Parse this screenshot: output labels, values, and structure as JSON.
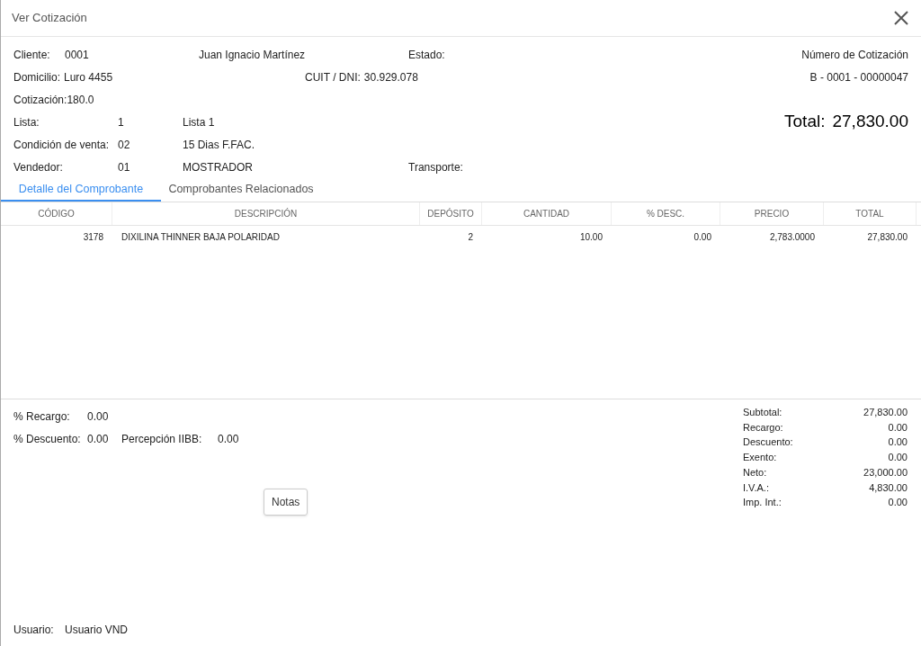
{
  "window": {
    "title": "Ver Cotización"
  },
  "header": {
    "cliente_label": "Cliente:",
    "cliente_code": "0001",
    "cliente_name": "Juan Ignacio Martínez",
    "estado_label": "Estado:",
    "numero_label": "Número de Cotización",
    "numero": "B - 0001 - 00000047",
    "domicilio_label": "Domicilio:",
    "domicilio": "Luro 4455",
    "cuit_label": "CUIT / DNI:",
    "cuit": "30.929.078",
    "cotizacion_label": "Cotización:",
    "cotizacion": "180.0",
    "total_label": "Total:",
    "total": "27,830.00"
  },
  "fields": [
    {
      "label": "Lista:",
      "code": "1",
      "name": "Lista 1"
    },
    {
      "label": "Condición de venta:",
      "code": "02",
      "name": "15 Dias F.FAC."
    },
    {
      "label": "Vendedor:",
      "code": "01",
      "name": "MOSTRADOR"
    }
  ],
  "transporte_label": "Transporte:",
  "tabs": [
    {
      "label": "Detalle del Comprobante",
      "selected": true
    },
    {
      "label": "Comprobantes Relacionados",
      "selected": false
    }
  ],
  "table": {
    "columns": [
      "CÓDIGO",
      "DESCRIPCIÓN",
      "DEPÓSITO",
      "CANTIDAD",
      "% DESC.",
      "PRECIO",
      "TOTAL"
    ],
    "rows": [
      [
        "3178",
        "DIXILINA THINNER BAJA POLARIDAD",
        "2",
        "10.00",
        "0.00",
        "2,783.0000",
        "27,830.00"
      ]
    ]
  },
  "footer": {
    "recargo_label": "% Recargo:",
    "recargo": "0.00",
    "descuento_label": "% Descuento:",
    "descuento": "0.00",
    "percepcion_label": "Percepción IIBB:",
    "percepcion": "0.00",
    "notas_button": "Notas",
    "usuario_label": "Usuario:",
    "usuario": "Usuario VND"
  },
  "totals": [
    {
      "label": "Subtotal:",
      "value": "27,830.00"
    },
    {
      "label": "Recargo:",
      "value": "0.00"
    },
    {
      "label": "Descuento:",
      "value": "0.00"
    },
    {
      "label": "Exento:",
      "value": "0.00"
    },
    {
      "label": "Neto:",
      "value": "23,000.00"
    },
    {
      "label": "I.V.A.:",
      "value": "4,830.00"
    },
    {
      "label": "Imp. Int.:",
      "value": "0.00"
    }
  ]
}
